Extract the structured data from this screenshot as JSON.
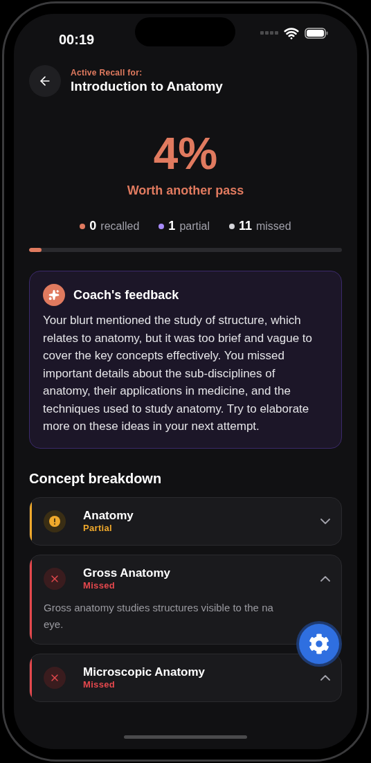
{
  "status_bar": {
    "time": "00:19"
  },
  "header": {
    "eyebrow": "Active Recall for:",
    "title": "Introduction to Anatomy"
  },
  "score": {
    "value": "4%",
    "verdict": "Worth another pass"
  },
  "stats": [
    {
      "count": "0",
      "label": "recalled",
      "color": "#e07a5f"
    },
    {
      "count": "1",
      "label": "partial",
      "color": "#a78bfa"
    },
    {
      "count": "11",
      "label": "missed",
      "color": "#d4d4d8"
    }
  ],
  "progress": {
    "level": 0.04
  },
  "feedback": {
    "title": "Coach's feedback",
    "text": "Your blurt mentioned the study of structure, which relates to anatomy, but it was too brief and vague to cover the key concepts effectively. You missed important details about the sub-disciplines of anatomy, their applications in medicine, and the techniques used to study anatomy. Try to elaborate more on these ideas in your next attempt."
  },
  "concepts": {
    "heading": "Concept breakdown",
    "items": [
      {
        "name": "Anatomy",
        "status": "Partial",
        "kind": "partial",
        "expanded": false
      },
      {
        "name": "Gross Anatomy",
        "status": "Missed",
        "kind": "missed",
        "expanded": true,
        "description_lines": [
          "Gross anatomy studies structures visible to the na",
          "eye."
        ]
      },
      {
        "name": "Microscopic Anatomy",
        "status": "Missed",
        "kind": "missed",
        "expanded": true
      }
    ]
  }
}
